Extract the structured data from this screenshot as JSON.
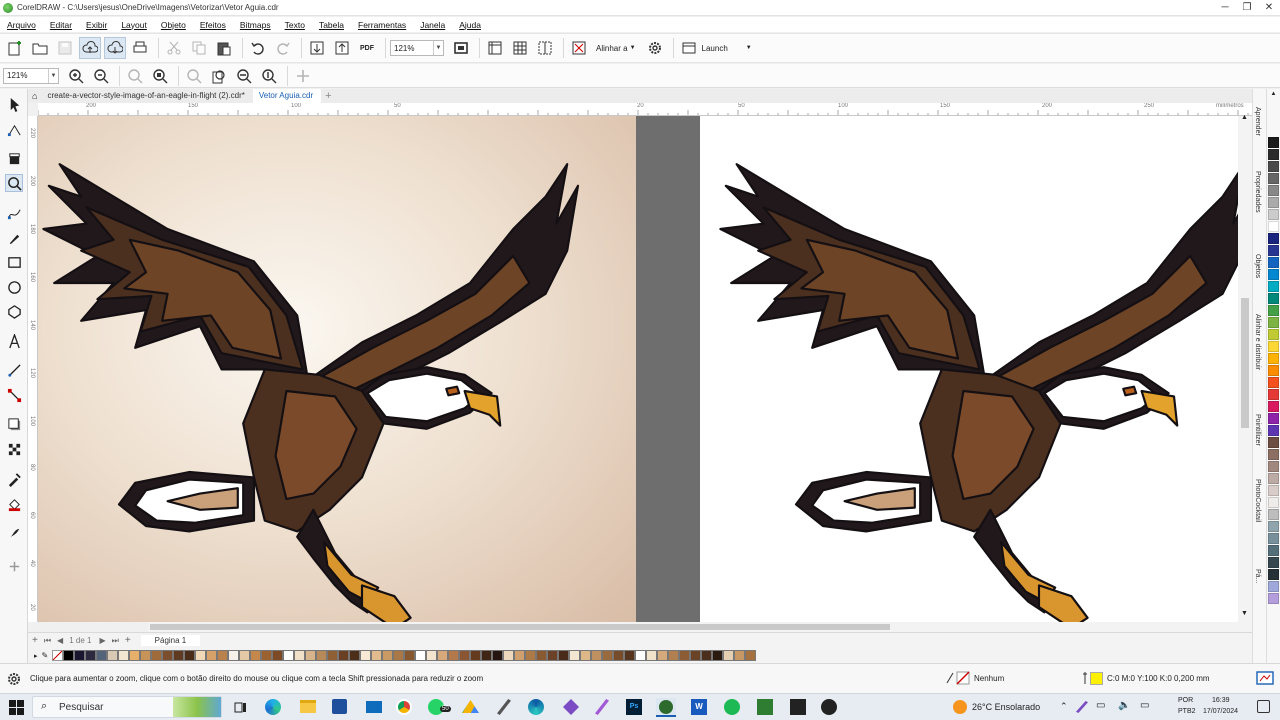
{
  "window": {
    "title": "CorelDRAW - C:\\Users\\jesus\\OneDrive\\Imagens\\Vetorizar\\Vetor Aguia.cdr",
    "controls": [
      "─",
      "❐",
      "✕"
    ]
  },
  "menu": [
    "Arquivo",
    "Editar",
    "Exibir",
    "Layout",
    "Objeto",
    "Efeitos",
    "Bitmaps",
    "Texto",
    "Tabela",
    "Ferramentas",
    "Janela",
    "Ajuda"
  ],
  "toolbar": {
    "zoom_value": "121%",
    "align_label": "Alinhar a",
    "launch_label": "Launch",
    "pdf_label": "PDF"
  },
  "zoombar": {
    "zoom_value": "121%"
  },
  "tabs": [
    {
      "label": "create-a-vector-style-image-of-an-eagle-in-flight (2).cdr*"
    },
    {
      "label": "Vetor Aguia.cdr"
    }
  ],
  "ruler": {
    "unit": "milímetros",
    "top_labels": [
      "200",
      "150",
      "100",
      "50",
      "20",
      "50",
      "100",
      "150",
      "200",
      "250"
    ],
    "left_labels": [
      "220",
      "200",
      "180",
      "160",
      "140",
      "120",
      "100",
      "80",
      "60",
      "40",
      "20"
    ]
  },
  "pagebar": {
    "counter": "1 de 1",
    "page_tab": "Página 1"
  },
  "dockers": [
    "Aprender",
    "Propriedades",
    "Objetos",
    "Alinhar e distribuir",
    "Pointillizer",
    "PhotoCocktail",
    "Pá..."
  ],
  "status": {
    "hint": "Clique para aumentar o zoom, clique com o botão direito do mouse ou clique com a tecla Shift pressionada para reduzir o zoom",
    "fill_label": "Nenhum",
    "outline_label": "C:0 M:0 Y:100 K:0  0,200 mm"
  },
  "taskbar": {
    "search_placeholder": "Pesquisar",
    "weather": "26°C  Ensolarado",
    "lang_top": "POR",
    "lang_bottom": "PTB2",
    "time": "16:39",
    "date": "17/07/2024",
    "whatsapp_badge": "50"
  },
  "colors": {
    "palette": [
      "#1a1a1a",
      "#2b2b2b",
      "#4a4a4a",
      "#666666",
      "#888888",
      "#aaaaaa",
      "#cccccc",
      "#ffffff",
      "#1a237e",
      "#283593",
      "#1565c0",
      "#0288d1",
      "#00acc1",
      "#00897b",
      "#43a047",
      "#7cb342",
      "#c0ca33",
      "#fdd835",
      "#ffb300",
      "#fb8c00",
      "#f4511e",
      "#e53935",
      "#d81b60",
      "#8e24aa",
      "#5e35b1",
      "#6d4c41",
      "#8d6e63",
      "#a1887f",
      "#bcaaa4",
      "#d7ccc8",
      "#efebe9",
      "#bdbdbd",
      "#90a4ae",
      "#78909c",
      "#546e7a",
      "#37474f",
      "#263238",
      "#9fa8da",
      "#b39ddb"
    ],
    "doc_palette": [
      "#000000",
      "#1b1630",
      "#2d2a40",
      "#53637a",
      "#d9c9b4",
      "#f3e6d0",
      "#e6b06a",
      "#c69359",
      "#a06b3b",
      "#7b4f2e",
      "#5e3a22",
      "#4a2c18",
      "#f1d9b8",
      "#d7a26a",
      "#b9824c",
      "#f5f0e9",
      "#e3c9a5",
      "#c4884c",
      "#9c6131",
      "#7e4a25",
      "#ffffff",
      "#f0e1c8",
      "#d8b48a",
      "#b88a5a",
      "#8f5f36",
      "#6a4024",
      "#4d2e19",
      "#f7e9d4",
      "#e2bc8e",
      "#c99a63",
      "#a97846",
      "#87582f",
      "#ffffff",
      "#f2e4cf",
      "#d6a87a",
      "#b3794b",
      "#8a5532",
      "#653b20",
      "#3f2614",
      "#241510",
      "#ecd8bd",
      "#cf9f6e",
      "#ad7a47",
      "#895a32",
      "#6b4127",
      "#4a2b1a",
      "#f4e7d2",
      "#deb889",
      "#bf9060",
      "#996a3d",
      "#774c2b",
      "#56351f",
      "#ffffff",
      "#f1e2ca",
      "#d4aa7c",
      "#b28050",
      "#8c5c35",
      "#6a4226",
      "#4b2e1b",
      "#2b1a10",
      "#e5cfb2",
      "#c79764",
      "#a4713f"
    ]
  }
}
